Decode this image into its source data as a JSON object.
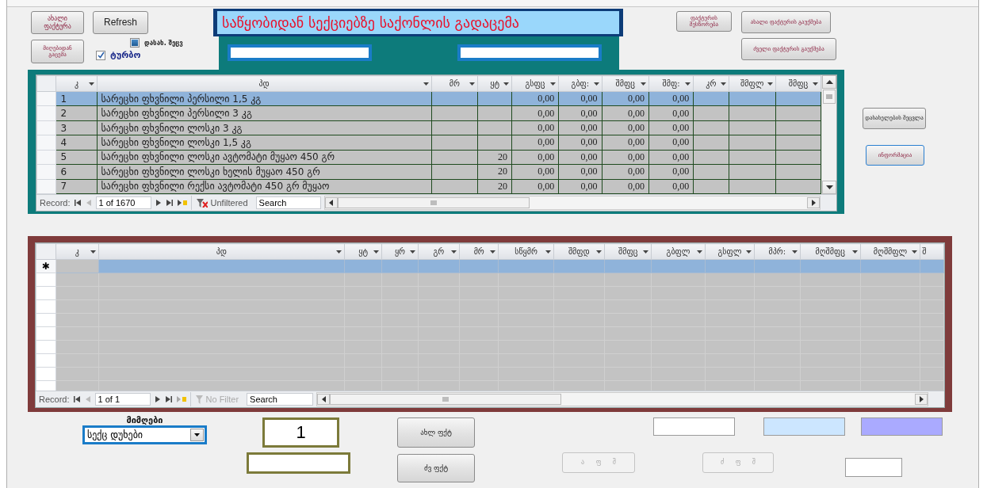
{
  "left_buttons": {
    "new_invoice": "ახალი ფაქტურა",
    "refresh": "Refresh",
    "from_receipt": "მიღებიდან გაცემა"
  },
  "checkboxes": [
    {
      "label": "დასახ. შეცვ",
      "checked": false
    },
    {
      "label": "ტურბო",
      "checked": true
    }
  ],
  "title": "საწყობიდან სექციებზე საქონლის გადაცემა",
  "right_buttons": [
    "ფაქტურის შესწორება",
    "ახალი ფაქტურის გაუქმება",
    "ძველი ფაქტურის გაუქმება"
  ],
  "products_grid": {
    "columns": [
      "კ",
      "პდ",
      "მრ",
      "ყტ",
      "გსფც",
      "გბფ:",
      "შმფც",
      "შმფ:",
      "კრ",
      "შმფლ",
      "შმფც"
    ],
    "rows": [
      {
        "number": "1",
        "name": "სარეცხი ფხვნილი პერსილი 1,5 კგ",
        "amounts": [
          "0,00",
          "0,00",
          "0,00",
          "0,00"
        ],
        "selected": true
      },
      {
        "number": "2",
        "name": "სარეცხი ფხვნილი პერსილი 3 კგ",
        "amounts": [
          "0,00",
          "0,00",
          "0,00",
          "0,00"
        ],
        "selected": false
      },
      {
        "number": "3",
        "name": "სარეცხი ფხვნილი ლოსკი 3 კგ",
        "amounts": [
          "0,00",
          "0,00",
          "0,00",
          "0,00"
        ],
        "selected": false
      },
      {
        "number": "4",
        "name": "სარეცხი ფხვნილი ლოსკი 1,5 კგ",
        "amounts": [
          "0,00",
          "0,00",
          "0,00",
          "0,00"
        ],
        "selected": false
      },
      {
        "number": "5",
        "name": "სარეცხი ფხვნილი ლოსკი ავტომატი მუყაო 450 გრ",
        "column_4": "20",
        "amounts": [
          "0,00",
          "0,00",
          "0,00",
          "0,00"
        ],
        "selected": false
      },
      {
        "number": "6",
        "name": "სარეცხი ფხვნილი ლოსკი ხელის მუყაო 450 გრ",
        "column_4": "20",
        "amounts": [
          "0,00",
          "0,00",
          "0,00",
          "0,00"
        ],
        "selected": false
      },
      {
        "number": "7",
        "name": "სარეცხი ფხვნილი რექსი ავტომატი 450 გრ მუყაო",
        "column_4": "20",
        "amounts": [
          "0,00",
          "0,00",
          "0,00",
          "0,00"
        ],
        "selected": false
      }
    ],
    "nav": {
      "label": "Record:",
      "position": "1 of 1670",
      "filter": "Unfiltered",
      "filter_disabled": false,
      "search": "Search"
    }
  },
  "side_buttons": [
    "დასახელების შეცვლა",
    "ინფორმაცია"
  ],
  "transfer_grid": {
    "columns": [
      "კ",
      "პდ",
      "ყტ",
      "ყრ",
      "გრ",
      "მრ",
      "სწყმრ",
      "შმფდ",
      "შმფც",
      "გბფლ",
      "გსფლ",
      "მპრ:",
      "მღშმფც",
      "მღშმფლ",
      "შ"
    ],
    "new_row_marker": "✱",
    "nav": {
      "label": "Record:",
      "position": "1 of 1",
      "filter": "No Filter",
      "filter_disabled": true,
      "search": "Search"
    }
  },
  "recipient": {
    "label": "მიმღები",
    "value": "სექც დუხები"
  },
  "number_field": {
    "value": "1"
  },
  "invoice_buttons": [
    {
      "label": "ახლ ფქტ",
      "disabled": false
    },
    {
      "label": "ძვ ფქტ",
      "disabled": false
    }
  ],
  "small_buttons": [
    {
      "label": "ა ფ შ",
      "disabled": true
    },
    {
      "label": "ძ ფ შ",
      "disabled": true
    }
  ],
  "color_fields": [
    {
      "color": "#ffffff"
    },
    {
      "color": "#cce6ff"
    },
    {
      "color": "#aaaaff"
    }
  ]
}
